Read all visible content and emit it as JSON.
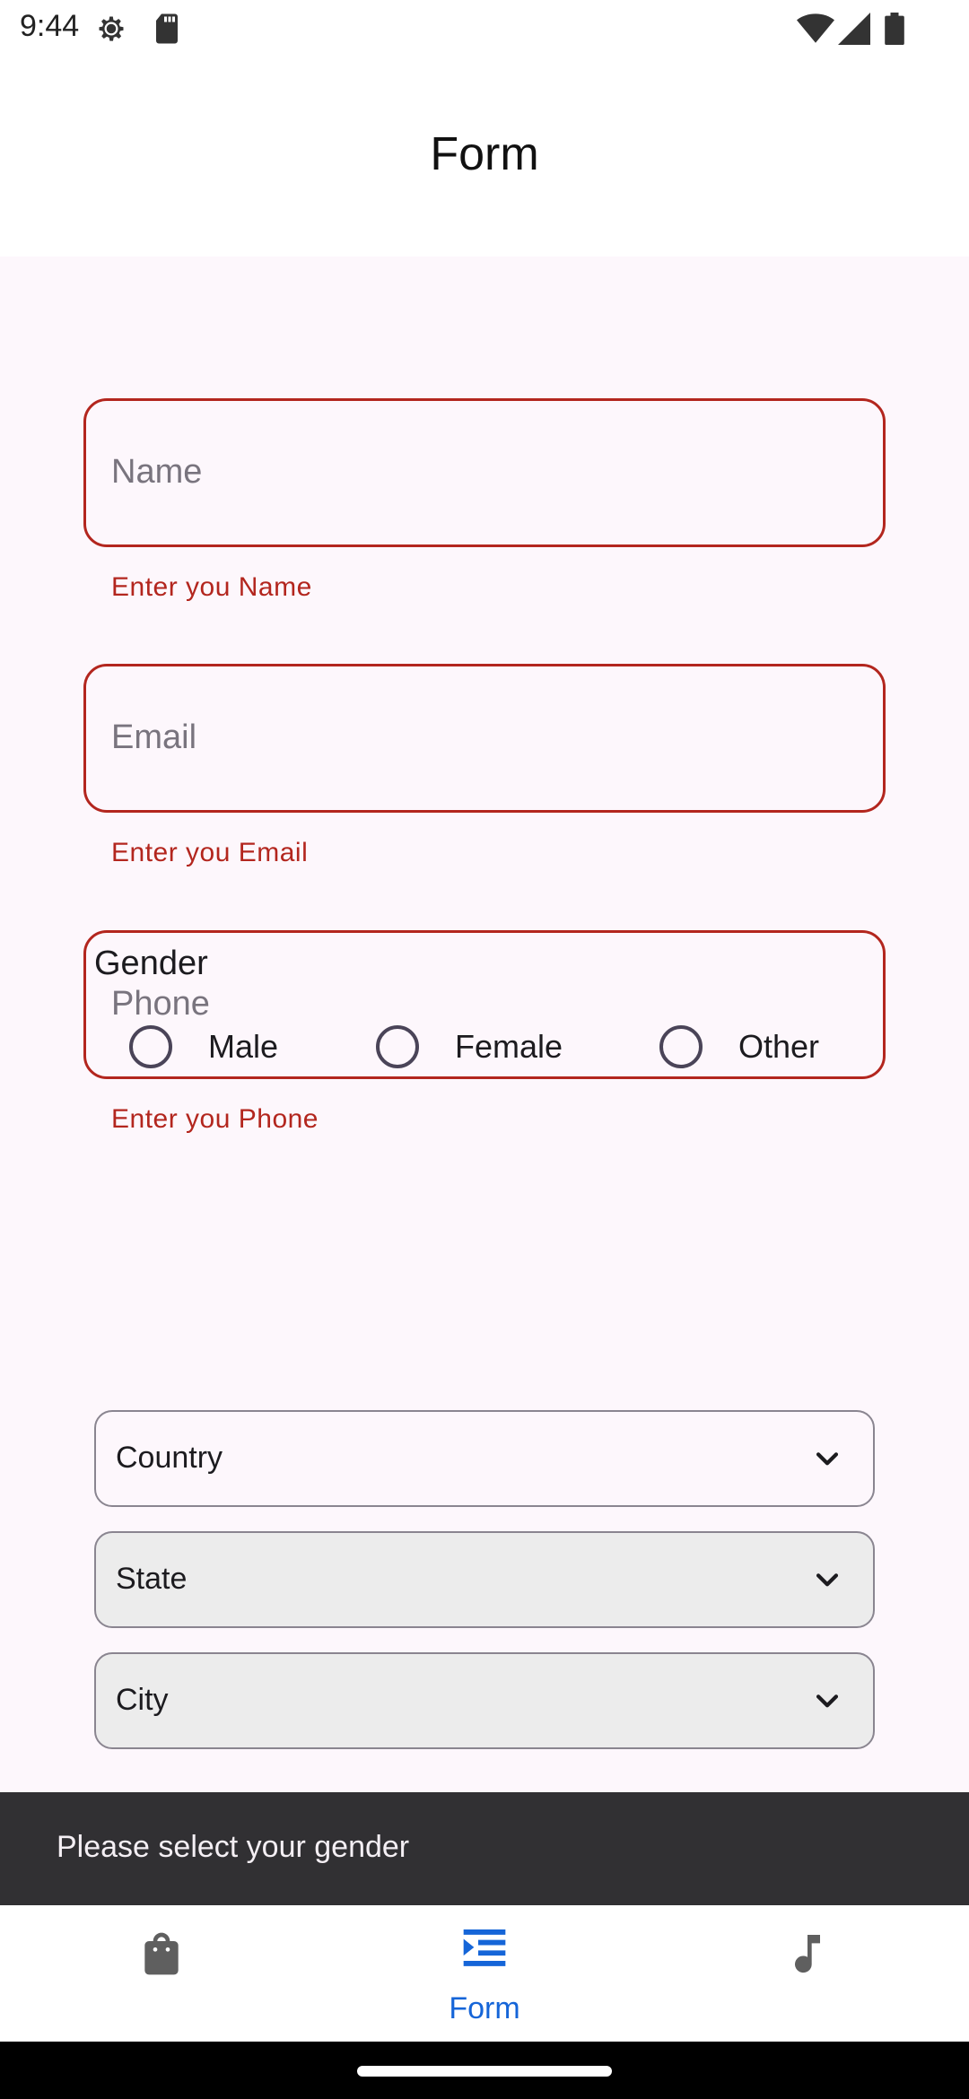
{
  "status_bar": {
    "time": "9:44",
    "icons": [
      "settings-gear-icon",
      "sd-card-icon",
      "wifi-icon",
      "cell-signal-icon",
      "battery-icon"
    ]
  },
  "app_bar": {
    "title": "Form"
  },
  "form": {
    "name": {
      "placeholder": "Name",
      "error": "Enter you Name"
    },
    "email": {
      "placeholder": "Email",
      "error": "Enter you Email"
    },
    "phone": {
      "placeholder": "Phone",
      "error": "Enter you Phone"
    },
    "gender": {
      "label": "Gender",
      "options": [
        "Male",
        "Female",
        "Other"
      ],
      "selected": null
    },
    "country": {
      "label": "Country"
    },
    "state": {
      "label": "State"
    },
    "city": {
      "label": "City"
    }
  },
  "snackbar": {
    "message": "Please select your gender"
  },
  "bottom_nav": {
    "items": [
      {
        "icon": "shopping-bag-icon",
        "label": ""
      },
      {
        "icon": "form-list-icon",
        "label": "Form",
        "active": true
      },
      {
        "icon": "music-note-icon",
        "label": ""
      }
    ]
  },
  "colors": {
    "error": "#b3261e",
    "accent": "#1565d8",
    "background": "#fdf7fc",
    "snackbar": "#313033"
  }
}
